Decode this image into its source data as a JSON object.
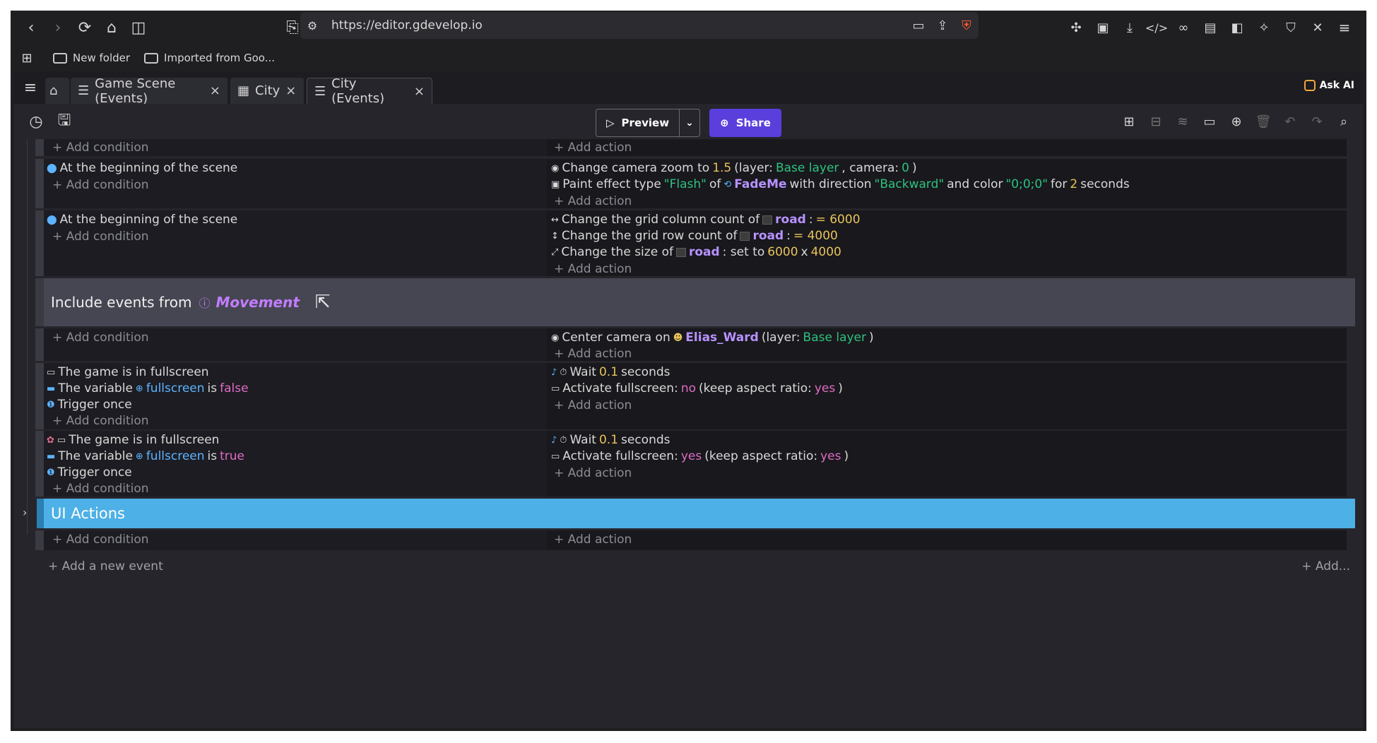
{
  "browser": {
    "url": "https://editor.gdevelop.io",
    "bookmarks": [
      "New folder",
      "Imported from Goo..."
    ]
  },
  "tabs": [
    {
      "label": "Game Scene (Events)"
    },
    {
      "label": "City"
    },
    {
      "label": "City (Events)"
    }
  ],
  "ask_ai": "Ask AI",
  "toolbar": {
    "preview": "Preview",
    "share": "Share"
  },
  "labels": {
    "add_condition": "+ Add condition",
    "add_action": "+ Add action",
    "add_new_event": "+ Add a new event",
    "add_more": "+ Add..."
  },
  "events": {
    "e1": {
      "cond": "At the beginning of the scene",
      "a1": {
        "t1": "Change camera zoom to ",
        "v1": "1.5",
        "t2": " (layer: ",
        "v2": "Base layer",
        "t3": ", camera: ",
        "v3": "0",
        "t4": ")"
      },
      "a2": {
        "t1": "Paint effect type ",
        "v1": "\"Flash\"",
        "t2": " of ",
        "obj": "FadeMe",
        "t3": " with direction ",
        "v2": "\"Backward\"",
        "t4": " and color ",
        "v3": "\"0;0;0\"",
        "t5": " for ",
        "v4": "2",
        "t6": " seconds"
      }
    },
    "e2": {
      "cond": "At the beginning of the scene",
      "a1": {
        "t1": "Change the grid column count of ",
        "obj": "road",
        "t2": ": ",
        "v1": "= 6000"
      },
      "a2": {
        "t1": "Change the grid row count of ",
        "obj": "road",
        "t2": ": ",
        "v1": "= 4000"
      },
      "a3": {
        "t1": "Change the size of ",
        "obj": "road",
        "t2": ": set to ",
        "v1": "6000",
        "t3": " x ",
        "v2": "4000"
      }
    },
    "include": {
      "label": "Include events from",
      "name": "Movement"
    },
    "e3": {
      "a1": {
        "t1": "Center camera on ",
        "obj": "Elias_Ward",
        "t2": " (layer: ",
        "v1": "Base layer",
        "t3": ")"
      }
    },
    "e4": {
      "c1": "The game is in fullscreen",
      "c2": {
        "t1": "The variable ",
        "var": "fullscreen",
        "t2": " is ",
        "v1": "false"
      },
      "c3": "Trigger once",
      "a1": {
        "t1": "Wait ",
        "v1": "0.1",
        "t2": " seconds"
      },
      "a2": {
        "t1": "Activate fullscreen: ",
        "v1": "no",
        "t2": " (keep aspect ratio: ",
        "v2": "yes",
        "t3": ")"
      }
    },
    "e5": {
      "c1": "The game is in fullscreen",
      "c2": {
        "t1": "The variable ",
        "var": "fullscreen",
        "t2": " is ",
        "v1": "true"
      },
      "c3": "Trigger once",
      "a1": {
        "t1": "Wait ",
        "v1": "0.1",
        "t2": " seconds"
      },
      "a2": {
        "t1": "Activate fullscreen: ",
        "v1": "yes",
        "t2": " (keep aspect ratio: ",
        "v2": "yes",
        "t3": ")"
      }
    },
    "group": "UI Actions"
  },
  "colors": {
    "share": "#5a3fdc",
    "group": "#4db0e6",
    "include": "#464653",
    "value": "#e9c35a",
    "string": "#2ec27e"
  }
}
